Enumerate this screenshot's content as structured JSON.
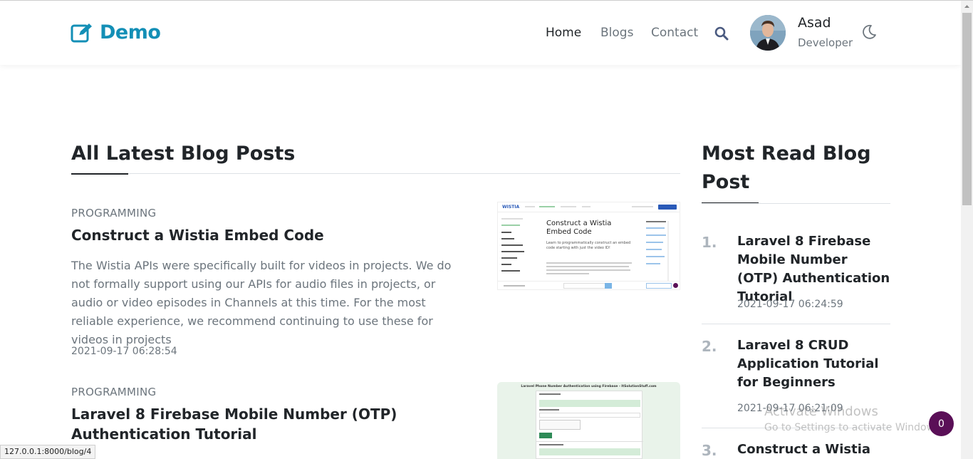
{
  "header": {
    "brand": "Demo",
    "nav": [
      "Home",
      "Blogs",
      "Contact"
    ],
    "user": {
      "name": "Asad",
      "role": "Developer"
    }
  },
  "main": {
    "section_title": "All Latest Blog Posts",
    "posts": [
      {
        "category": "PROGRAMMING",
        "title": "Construct a Wistia Embed Code",
        "excerpt": "The Wistia APIs were specifically built for videos in projects. We do not formally support using our APIs for audio files in projects, or audio or video episodes in Channels at this time. For the most reliable experience, we recommend continuing to use these for videos in projects",
        "date": "2021-09-17 06:28:54",
        "thumb": {
          "logo": "WISTIA",
          "heading": "Construct a Wistia Embed Code",
          "sub": "Learn to programmatically construct an embed code starting with just the video ID!"
        }
      },
      {
        "category": "PROGRAMMING",
        "title": "Laravel 8 Firebase Mobile Number (OTP) Authentication Tutorial",
        "thumb": {
          "heading": "Laravel Phone Number Authentication using Firebase - ItSolutionStuff.com"
        }
      }
    ]
  },
  "sidebar": {
    "title": "Most Read Blog Post",
    "items": [
      {
        "num": "1.",
        "title": "Laravel 8 Firebase Mobile Number (OTP) Authentication Tutorial",
        "date": "2021-09-17 06:24:59"
      },
      {
        "num": "2.",
        "title": "Laravel 8 CRUD Application Tutorial for Beginners",
        "date": "2021-09-17 06:21:09"
      },
      {
        "num": "3.",
        "title": "Construct a Wistia"
      }
    ]
  },
  "status_bar": {
    "url": "127.0.0.1:8000/blog/4"
  },
  "watermark": {
    "line1": "Activate Windows",
    "line2": "Go to Settings to activate Windows."
  },
  "badge": {
    "count": "0"
  },
  "colors": {
    "brand": "#138fb6",
    "badge": "#5a0f57"
  }
}
